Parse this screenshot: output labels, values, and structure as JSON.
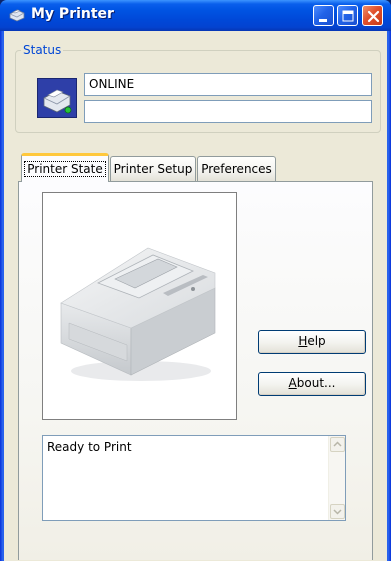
{
  "window": {
    "title": "My Printer",
    "colors": {
      "titlebar": "#0054e3",
      "client_bg": "#ece9d8",
      "group_label": "#0046d5",
      "active_tab_accent": "#ffc83c"
    }
  },
  "titlebar_buttons": [
    {
      "name": "minimize",
      "icon": "minimize-icon"
    },
    {
      "name": "maximize",
      "icon": "maximize-icon"
    },
    {
      "name": "close",
      "icon": "close-icon"
    }
  ],
  "status": {
    "label": "Status",
    "line1": "ONLINE",
    "line2": ""
  },
  "tabs": [
    {
      "label": "Printer State",
      "active": true
    },
    {
      "label": "Printer Setup",
      "active": false
    },
    {
      "label": "Preferences",
      "active": false
    }
  ],
  "buttons": {
    "help": {
      "mnemonic": "H",
      "rest": "elp"
    },
    "about": {
      "mnemonic": "A",
      "rest": "bout..."
    }
  },
  "message": "Ready to Print"
}
